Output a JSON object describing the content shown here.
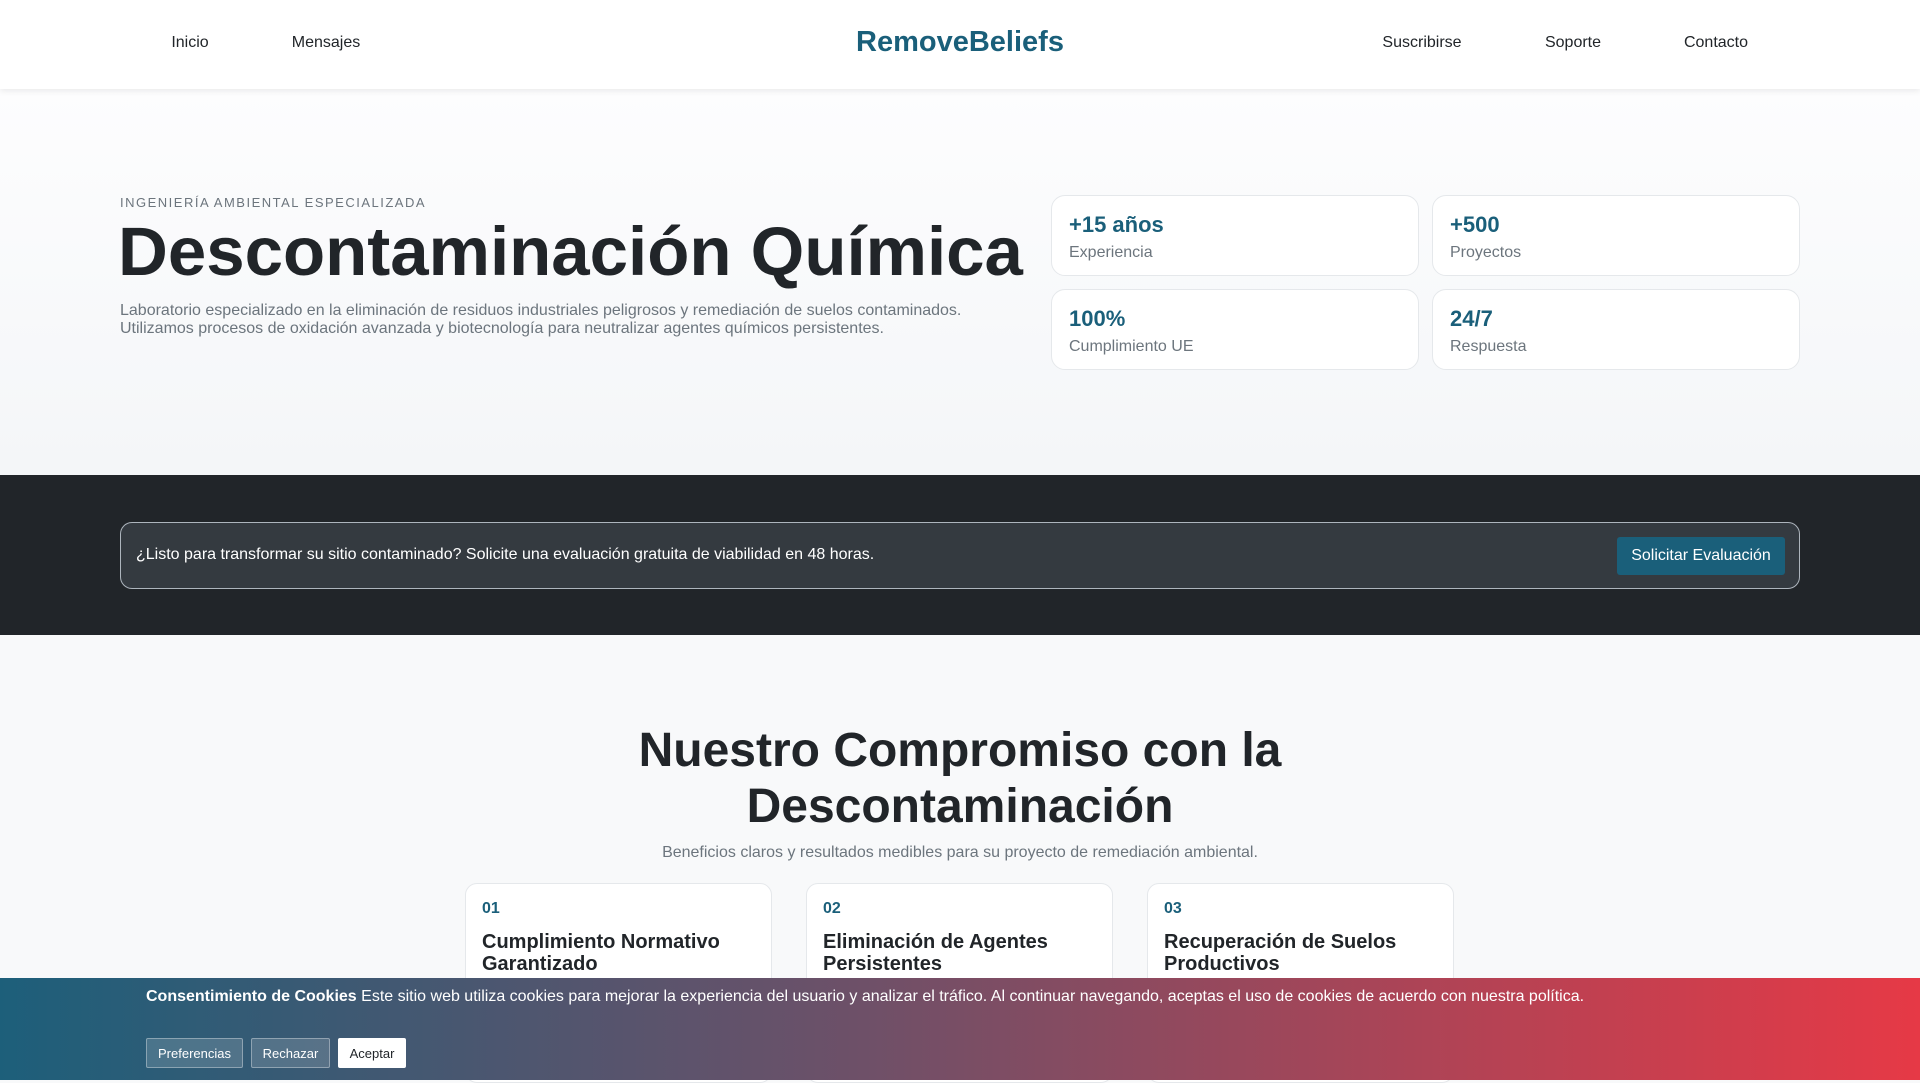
{
  "nav": {
    "left": [
      "Inicio",
      "Mensajes"
    ],
    "logo": "RemoveBeliefs",
    "right": [
      "Suscribirse",
      "Soporte",
      "Contacto"
    ]
  },
  "hero": {
    "eyebrow": "INGENIERÍA AMBIENTAL ESPECIALIZADA",
    "title": "Descontaminación Química",
    "lead": "Laboratorio especializado en la eliminación de residuos industriales peligrosos y remediación de suelos contaminados. Utilizamos procesos de oxidación avanzada y biotecnología para neutralizar agentes químicos persistentes.",
    "stats": [
      {
        "value": "+15 años",
        "label": "Experiencia"
      },
      {
        "value": "+500",
        "label": "Proyectos"
      },
      {
        "value": "100%",
        "label": "Cumplimiento UE"
      },
      {
        "value": "24/7",
        "label": "Respuesta"
      }
    ]
  },
  "cta": {
    "text": "¿Listo para transformar su sitio contaminado? Solicite una evaluación gratuita de viabilidad en 48 horas.",
    "button": "Solicitar Evaluación"
  },
  "commitment": {
    "title": "Nuestro Compromiso con la Descontaminación",
    "subtitle": "Beneficios claros y resultados medibles para su proyecto de remediación ambiental.",
    "cards": [
      {
        "num": "01",
        "title": "Cumplimiento Normativo Garantizado"
      },
      {
        "num": "02",
        "title": "Eliminación de Agentes Persistentes"
      },
      {
        "num": "03",
        "title": "Recuperación de Suelos Productivos"
      }
    ]
  },
  "cookie": {
    "title": "Consentimiento de Cookies",
    "text": " Este sitio web utiliza cookies para mejorar la experiencia del usuario y analizar el tráfico. Al continuar navegando, aceptas el uso de cookies de acuerdo con nuestra política.",
    "buttons": [
      "Preferencias",
      "Rechazar",
      "Aceptar"
    ]
  },
  "colors": {
    "brand": "#1a5f7a",
    "dark": "#212529",
    "accent": "#e63946"
  }
}
